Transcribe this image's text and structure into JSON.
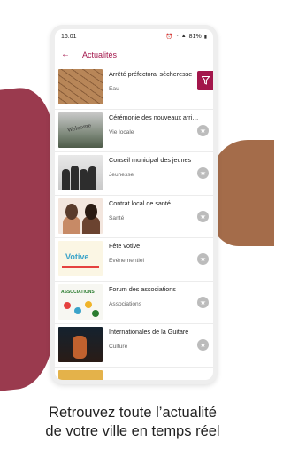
{
  "status_bar": {
    "time": "16:01",
    "battery": "81%"
  },
  "app_bar": {
    "title": "Actualités"
  },
  "news_items": [
    {
      "title": "Arrêté préfectoral sécheresse",
      "category": "Eau"
    },
    {
      "title": "Cérémonie des nouveaux arriva...",
      "category": "Vie locale"
    },
    {
      "title": "Conseil municipal des jeunes",
      "category": "Jeunesse"
    },
    {
      "title": "Contrat local de santé",
      "category": "Santé"
    },
    {
      "title": "Fête votive",
      "category": "Evénementiel"
    },
    {
      "title": "Forum des associations",
      "category": "Associations"
    },
    {
      "title": "Internationales de la Guitare",
      "category": "Culture"
    }
  ],
  "thumb_text": {
    "welcome": "Welcome",
    "fete": "Votive",
    "forum": "ASSOCIATIONS"
  },
  "caption": {
    "line1": "Retrouvez toute l’actualité",
    "line2": "de votre ville en temps réel"
  },
  "colors": {
    "accent": "#a3164b",
    "bg_left": "#9a3a4e",
    "bg_right": "#a46c4a"
  },
  "icons": {
    "back": "arrow-left-icon",
    "filter": "funnel-icon",
    "favorite": "star-icon"
  }
}
